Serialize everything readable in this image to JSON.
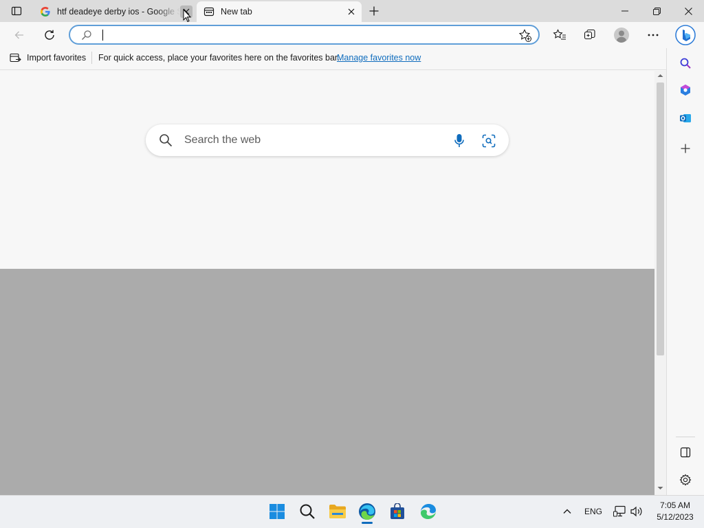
{
  "tabs": [
    {
      "title": "htf deadeye derby ios - Google S",
      "favicon": "google-icon",
      "active": false
    },
    {
      "title": "New tab",
      "favicon": "new-tab-page-icon",
      "active": true
    }
  ],
  "address_bar": {
    "value": "",
    "placeholder": ""
  },
  "favorites_bar": {
    "import_label": "Import favorites",
    "hint": "For quick access, place your favorites here on the favorites bar.",
    "manage_link": "Manage favorites now"
  },
  "new_tab_page": {
    "search_placeholder": "Search the web"
  },
  "sidebar": {
    "items": [
      "search-icon",
      "copilot-icon",
      "outlook-icon",
      "add-icon"
    ],
    "footer": [
      "split-screen-icon",
      "settings-icon"
    ]
  },
  "taskbar": {
    "apps": [
      "windows-start-icon",
      "search-icon",
      "file-explorer-icon",
      "edge-icon",
      "microsoft-store-icon",
      "edge-beta-icon"
    ],
    "tray": {
      "language": "ENG",
      "time": "7:05 AM",
      "date": "5/12/2023"
    }
  },
  "colors": {
    "accent": "#0f6cbd",
    "focus_border": "#5f9ed8",
    "page_overlay": "#ababab"
  }
}
